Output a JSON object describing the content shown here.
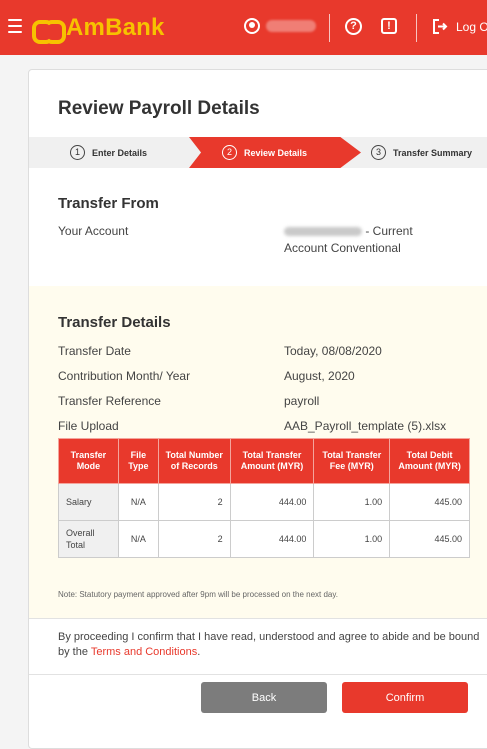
{
  "header": {
    "brand": "AmBank",
    "logout_label": "Log O"
  },
  "page": {
    "title": "Review Payroll Details"
  },
  "stepper": [
    {
      "num": "1",
      "label": "Enter Details"
    },
    {
      "num": "2",
      "label": "Review Details"
    },
    {
      "num": "3",
      "label": "Transfer Summary"
    }
  ],
  "transfer_from": {
    "title": "Transfer From",
    "account_label": "Your Account",
    "account_suffix": " - Current",
    "account_type": "Account Conventional"
  },
  "transfer_details": {
    "title": "Transfer Details",
    "rows": [
      {
        "label": "Transfer Date",
        "value": "Today, 08/08/2020"
      },
      {
        "label": "Contribution Month/ Year",
        "value": "August, 2020"
      },
      {
        "label": "Transfer Reference",
        "value": "payroll"
      },
      {
        "label": "File Upload",
        "value": "AAB_Payroll_template (5).xlsx"
      }
    ]
  },
  "table": {
    "headers": [
      "Transfer Mode",
      "File Type",
      "Total Number of Records",
      "Total Transfer Amount (MYR)",
      "Total Transfer Fee (MYR)",
      "Total Debit Amount (MYR)"
    ],
    "rows": [
      {
        "mode": "Salary",
        "type": "N/A",
        "records": "2",
        "amount": "444.00",
        "fee": "1.00",
        "debit": "445.00"
      },
      {
        "mode": "Overall Total",
        "type": "N/A",
        "records": "2",
        "amount": "444.00",
        "fee": "1.00",
        "debit": "445.00"
      }
    ]
  },
  "note": "Note: Statutory payment approved after 9pm will be processed on the next day.",
  "consent": {
    "text": "By proceeding I confirm that I have read, understood and agree to abide and be bound by the ",
    "link": "Terms and Conditions",
    "end": "."
  },
  "buttons": {
    "back": "Back",
    "confirm": "Confirm"
  },
  "colors": {
    "brand_red": "#e8392c",
    "brand_yellow": "#f7c200"
  }
}
